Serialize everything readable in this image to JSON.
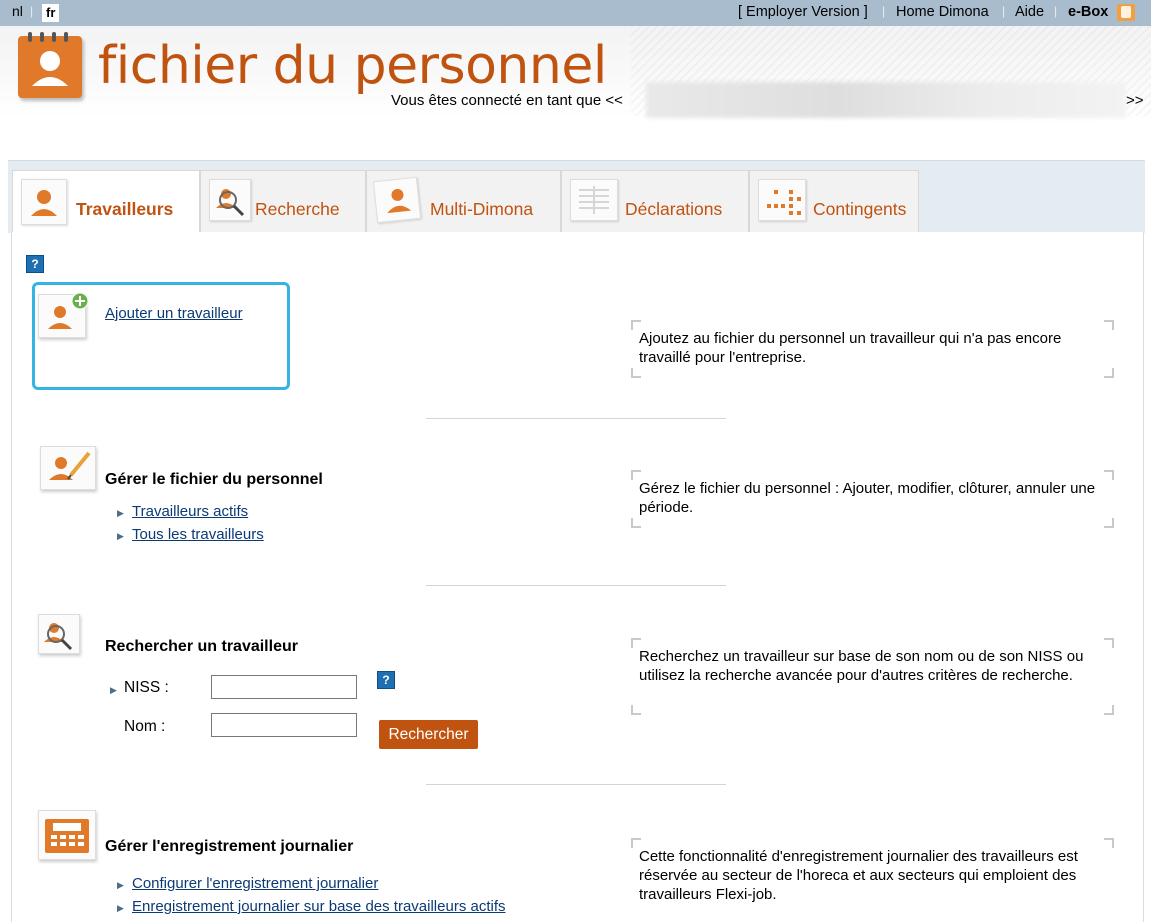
{
  "topbar": {
    "lang_nl": "nl",
    "lang_fr": "fr",
    "employer_version": "[ Employer Version ]",
    "home_dimona": "Home Dimona",
    "aide": "Aide",
    "ebox": "e-Box",
    "ebox_badge_color": "#f0a040"
  },
  "header": {
    "title": "fichier du personnel",
    "connected_prefix": "Vous êtes connecté en tant que <<",
    "connected_suffix": ">>",
    "title_color": "#c0530f"
  },
  "tabs": [
    {
      "label": "Travailleurs",
      "icon": "person-icon",
      "active": true
    },
    {
      "label": "Recherche",
      "icon": "person-search-icon",
      "active": false
    },
    {
      "label": "Multi-Dimona",
      "icon": "multi-person-icon",
      "active": false
    },
    {
      "label": "Déclarations",
      "icon": "document-icon",
      "active": false
    },
    {
      "label": "Contingents",
      "icon": "dots-grid-icon",
      "active": false
    }
  ],
  "sections": {
    "add": {
      "link": "Ajouter un travailleur",
      "desc": "Ajoutez au fichier du personnel un travailleur qui n'a pas encore travaillé pour l'entreprise."
    },
    "manage": {
      "title": "Gérer le fichier du personnel",
      "links": [
        "Travailleurs actifs",
        "Tous les travailleurs"
      ],
      "desc": "Gérez le fichier du personnel : Ajouter, modifier, clôturer, annuler une période."
    },
    "search": {
      "title": "Rechercher un travailleur",
      "niss_label": "NISS :",
      "nom_label": "Nom :",
      "niss_value": "",
      "nom_value": "",
      "button": "Rechercher",
      "desc": "Recherchez un travailleur sur base de son nom ou de son NISS ou utilisez la recherche avancée pour d'autres critères de recherche."
    },
    "daily": {
      "title": "Gérer l'enregistrement journalier",
      "links": [
        "Configurer l'enregistrement journalier",
        "Enregistrement journalier sur base des travailleurs actifs"
      ],
      "desc": "Cette fonctionnalité d'enregistrement journalier des travailleurs est réservée au secteur de l'horeca et aux secteurs qui emploient des travailleurs Flexi-job."
    }
  },
  "help_glyph": "?"
}
